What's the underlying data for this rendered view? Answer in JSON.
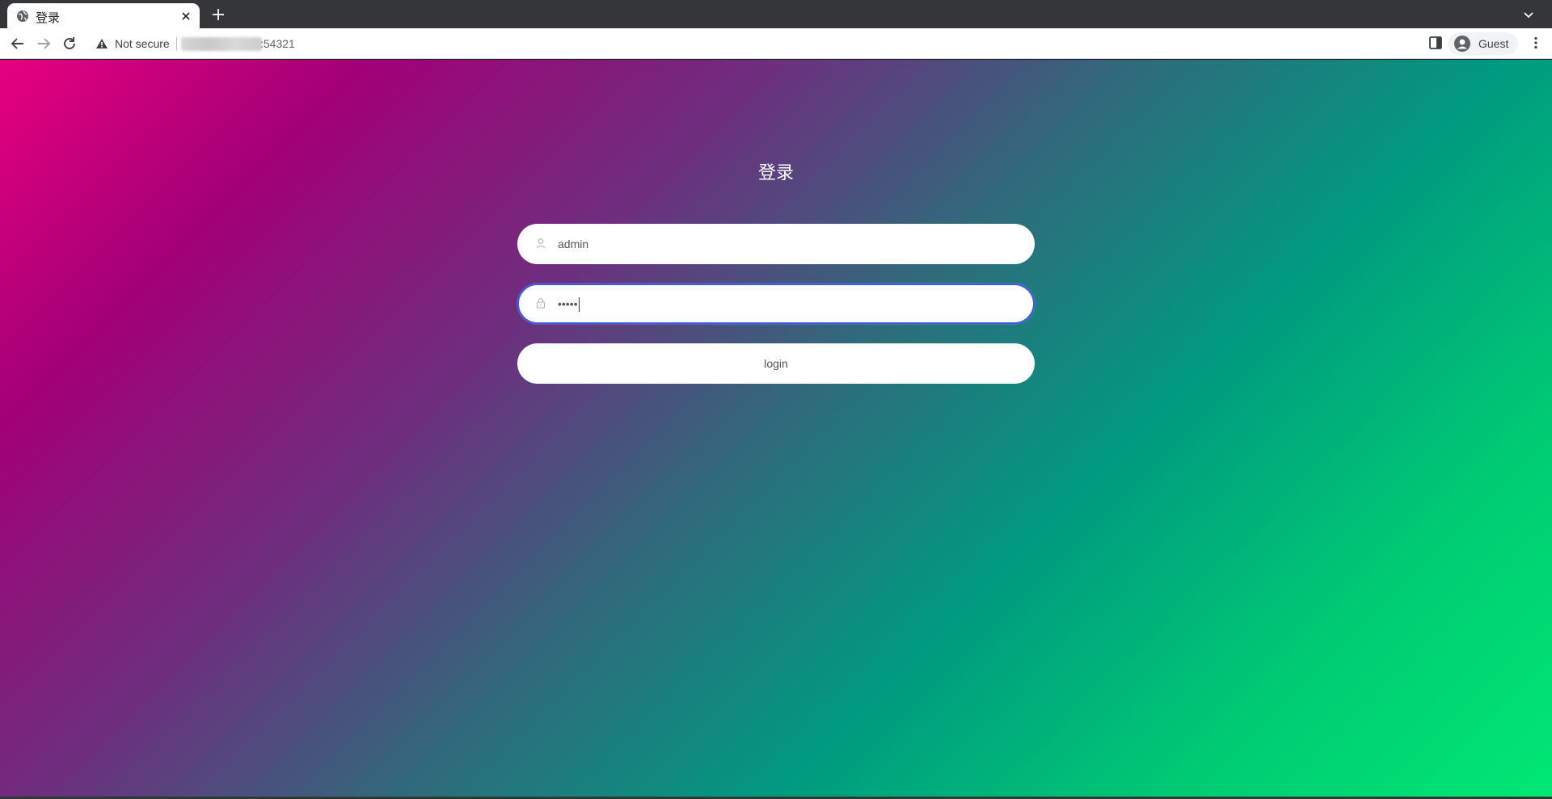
{
  "browser": {
    "tab": {
      "title": "登录",
      "favicon": "globe-icon"
    },
    "toolbar": {
      "security_text": "Not secure",
      "url_visible": ":54321",
      "profile_name": "Guest"
    }
  },
  "page": {
    "title": "登录",
    "username": {
      "value": "admin",
      "icon": "user-icon"
    },
    "password": {
      "value": "admin",
      "icon": "lock-icon"
    },
    "login_label": "login"
  },
  "colors": {
    "gradient_start": "#e6007e",
    "gradient_mid": "#2f6b7c",
    "gradient_end": "#00e874",
    "focus_border": "#3b5bdb"
  }
}
